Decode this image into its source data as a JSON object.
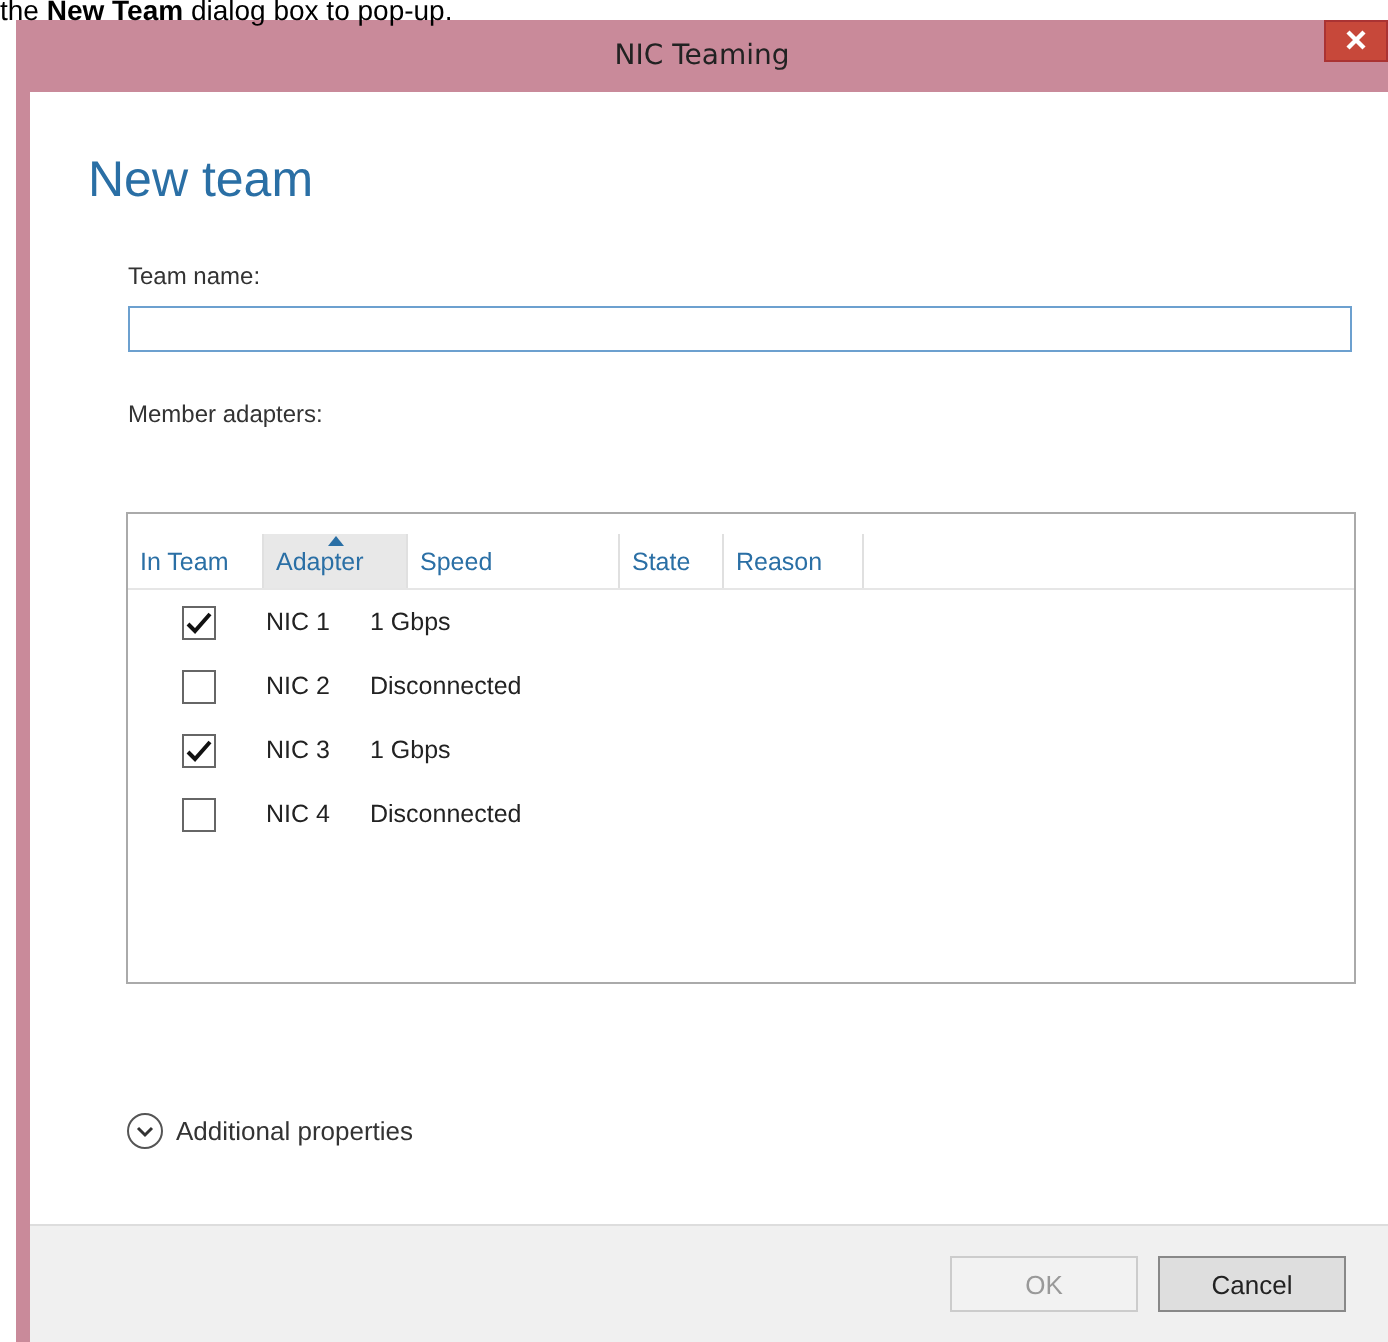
{
  "caption": "the **New Team** dialog box to pop-up.",
  "window": {
    "title": "NIC Teaming"
  },
  "heading": "New team",
  "team_name": {
    "label": "Team name:"
  },
  "member_adapters": {
    "label": "Member adapters:",
    "columns": [
      {
        "label": "In Team",
        "sorted": false
      },
      {
        "label": "Adapter",
        "sorted": true
      },
      {
        "label": "Speed",
        "sorted": false
      },
      {
        "label": "State",
        "sorted": false
      },
      {
        "label": "Reason",
        "sorted": false
      }
    ],
    "rows": [
      {
        "checked": true,
        "adapter": "NIC 1",
        "speed": "1 Gbps"
      },
      {
        "checked": false,
        "adapter": "NIC 2",
        "speed": "Disconnected"
      },
      {
        "checked": true,
        "adapter": "NIC 3",
        "speed": "1 Gbps"
      },
      {
        "checked": false,
        "adapter": "NIC 4",
        "speed": "Disconnected"
      }
    ]
  },
  "additional_properties": {
    "label": "Additional properties",
    "expanded": false
  },
  "buttons": [
    {
      "label": "OK",
      "disabled": true
    },
    {
      "label": "Cancel",
      "disabled": false
    }
  ]
}
